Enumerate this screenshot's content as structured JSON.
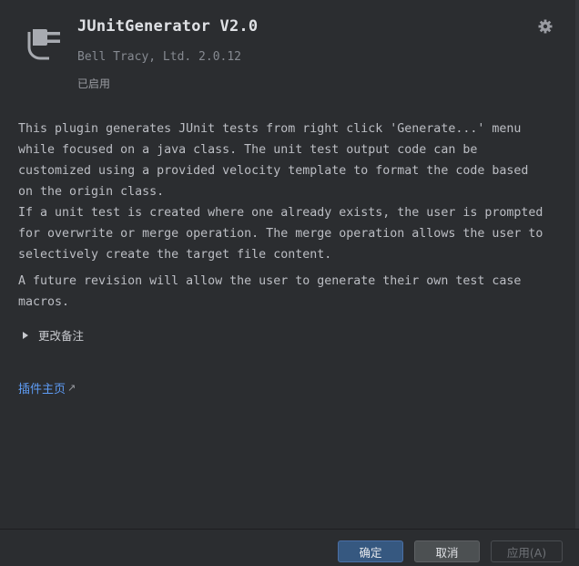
{
  "plugin": {
    "name": "JUnitGenerator V2.0",
    "vendor_version": "Bell Tracy, Ltd. 2.0.12",
    "status": "已启用",
    "icon": "plug-icon"
  },
  "description": {
    "lines": [
      "This plugin generates JUnit tests from right click 'Generate...' menu",
      "while focused on a java class. The unit test output code can be",
      "customized using a provided velocity template to format the code based",
      "on the origin class.",
      "If a unit test is created where one already exists, the user is prompted",
      "for overwrite or merge operation. The merge operation allows the user to",
      "selectively create the target file content."
    ],
    "para2_lines": [
      "A future revision will allow the user to generate their own test case",
      "macros."
    ]
  },
  "change_notes_label": "更改备注",
  "homepage_label": "插件主页",
  "homepage_arrow": "↗",
  "buttons": {
    "ok": "确定",
    "cancel": "取消",
    "apply": "应用(A)"
  },
  "colors": {
    "background": "#2b2d30",
    "link": "#5e9cf5",
    "primary_button": "#365880"
  }
}
